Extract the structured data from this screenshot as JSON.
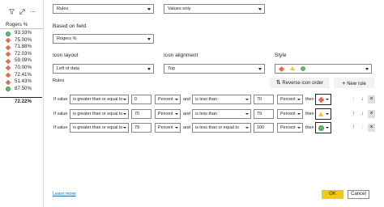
{
  "visual": {
    "header": "Rogers %",
    "rows": [
      {
        "icon": "circle",
        "value": "93.33%"
      },
      {
        "icon": "diamond",
        "value": "75.00%"
      },
      {
        "icon": "diamond",
        "value": "71.88%"
      },
      {
        "icon": "diamond",
        "value": "72.03%"
      },
      {
        "icon": "diamond",
        "value": "59.09%"
      },
      {
        "icon": "diamond",
        "value": "70.00%"
      },
      {
        "icon": "diamond",
        "value": "72.41%"
      },
      {
        "icon": "diamond",
        "value": "51.43%"
      },
      {
        "icon": "circle",
        "value": "87.50%"
      }
    ],
    "total": "72.22%"
  },
  "format_style": "Rules",
  "apply_to": "Values only",
  "based_on_field_label": "Based on field",
  "based_on_field": "Rogers %",
  "icon_layout_label": "Icon layout",
  "icon_layout": "Left of data",
  "icon_alignment_label": "Icon alignment",
  "icon_alignment": "Top",
  "style_label": "Style",
  "rules_label": "Rules",
  "reverse_icon_order": "Reverse icon order",
  "new_rule": "New rule",
  "rules": [
    {
      "if_value": "If value",
      "op1": "is greater than or equal to",
      "v1": "0",
      "unit1": "Percent",
      "and": "and",
      "op2": "is less than",
      "v2": "70",
      "unit2": "Percent",
      "then": "then",
      "icon": "diamond"
    },
    {
      "if_value": "If value",
      "op1": "is greater than or equal to",
      "v1": "70",
      "unit1": "Percent",
      "and": "and",
      "op2": "is less than",
      "v2": "79",
      "unit2": "Percent",
      "then": "then",
      "icon": "triangle"
    },
    {
      "if_value": "If value",
      "op1": "is greater than or equal to",
      "v1": "79",
      "unit1": "Percent",
      "and": "and",
      "op2": "is less than or equal to",
      "v2": "100",
      "unit2": "Percent",
      "then": "then",
      "icon": "circle"
    }
  ],
  "learn_more": "Learn more",
  "ok": "OK",
  "cancel": "Cancel",
  "colors": {
    "red": "#e9674f",
    "yellow": "#f2c43d",
    "green": "#5fb967",
    "ok_bg": "#f2c811",
    "link": "#0f6cbd"
  }
}
